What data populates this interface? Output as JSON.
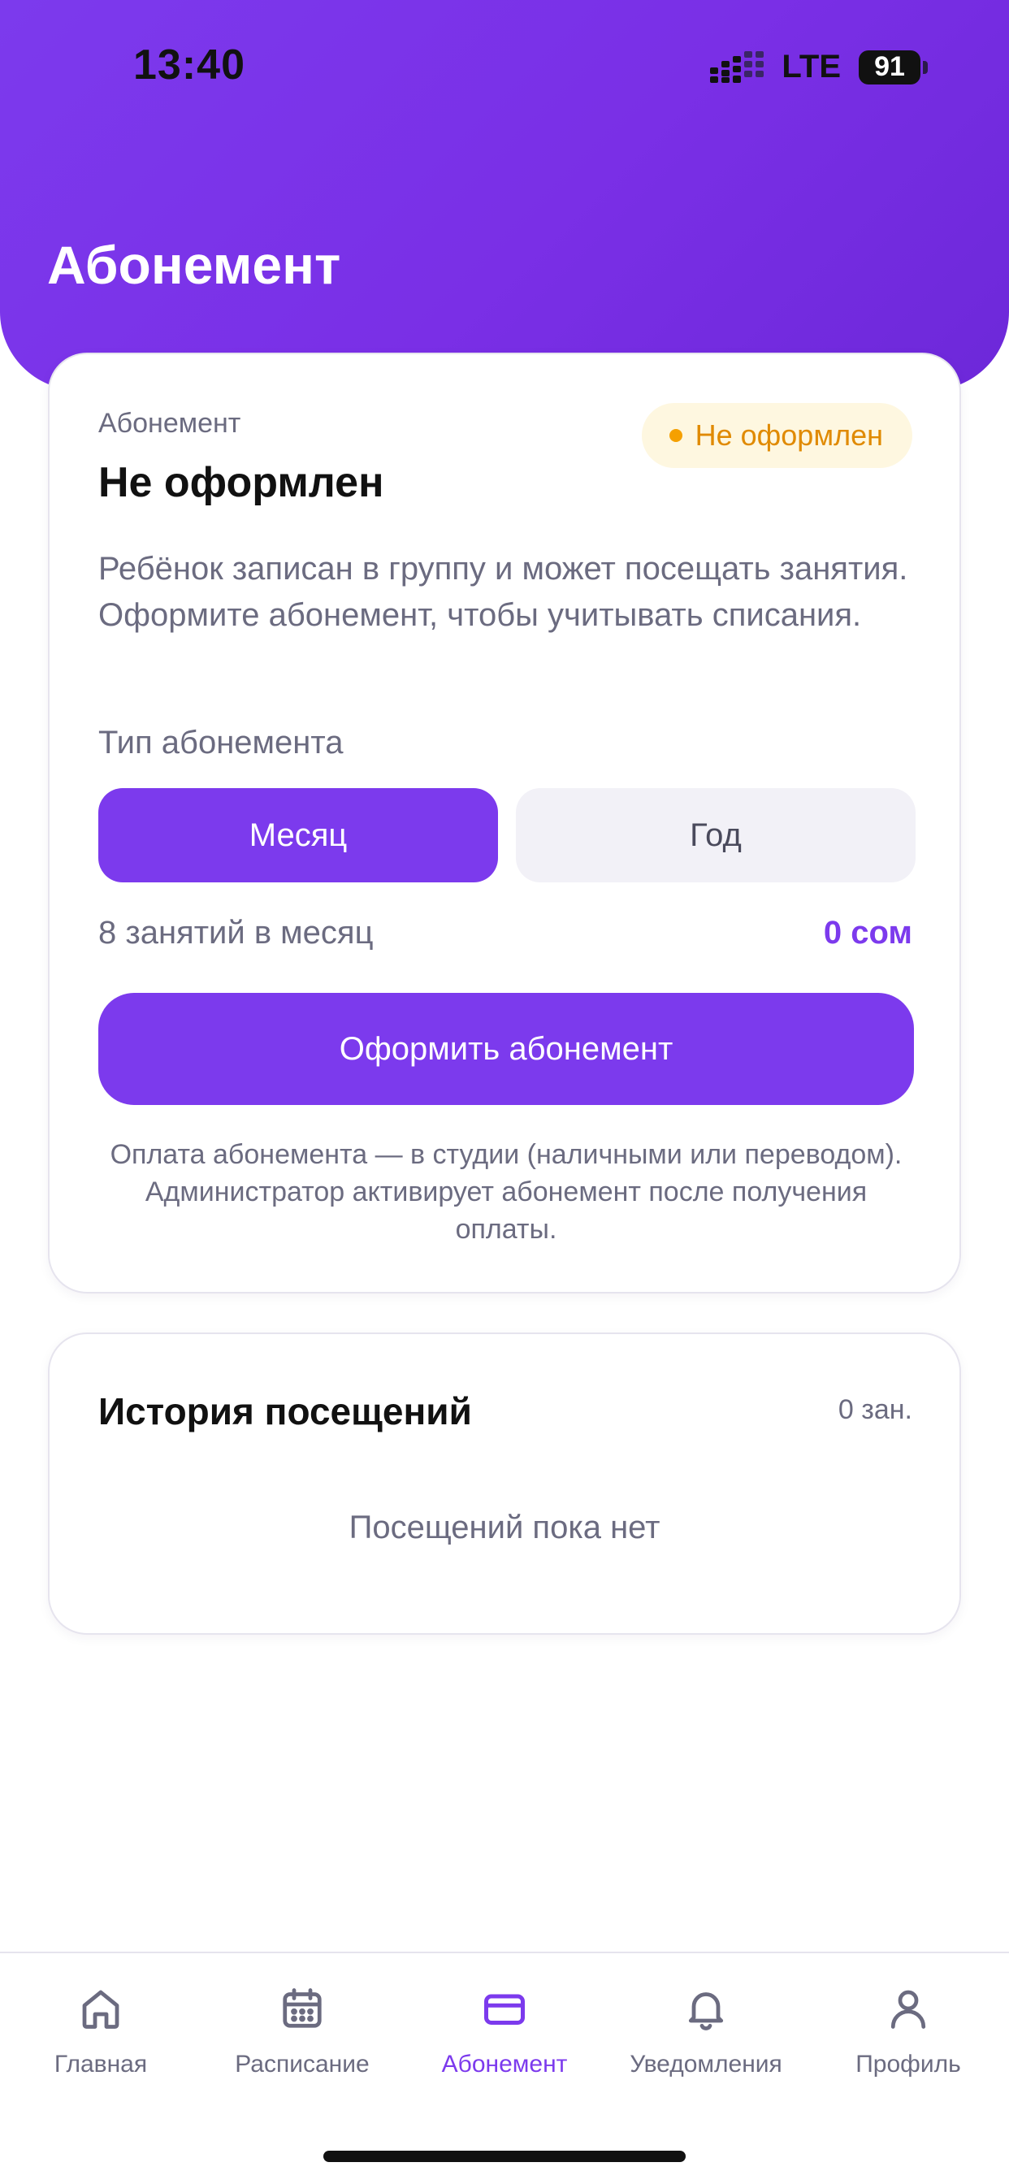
{
  "status_bar": {
    "time": "13:40",
    "network": "LTE",
    "battery": "91"
  },
  "header": {
    "title": "Абонемент"
  },
  "subscription_card": {
    "label": "Абонемент",
    "title": "Не оформлен",
    "badge": "Не оформлен",
    "description": "Ребёнок записан в группу и может посещать занятия. Оформите абонемент, чтобы учитывать списания.",
    "type_label": "Тип абонемента",
    "options": {
      "month": "Месяц",
      "year": "Год"
    },
    "selected_option": "Месяц",
    "lessons_info": "8 занятий в месяц",
    "price": "0 сом",
    "cta": "Оформить абонемент",
    "payment_note": "Оплата абонемента — в студии (наличными или переводом). Администратор активирует абонемент после получения оплаты."
  },
  "history_card": {
    "title": "История посещений",
    "count": "0 зан.",
    "empty": "Посещений пока нет"
  },
  "bottom_nav": {
    "active": "Абонемент",
    "items": [
      {
        "label": "Главная",
        "icon": "home-icon"
      },
      {
        "label": "Расписание",
        "icon": "calendar-icon"
      },
      {
        "label": "Абонемент",
        "icon": "card-icon"
      },
      {
        "label": "Уведомления",
        "icon": "bell-icon"
      },
      {
        "label": "Профиль",
        "icon": "user-icon"
      }
    ]
  },
  "colors": {
    "accent": "#7c3aed",
    "badge_text": "#e08a00",
    "badge_bg": "#fef7e0",
    "muted_text": "#6b6b80"
  }
}
